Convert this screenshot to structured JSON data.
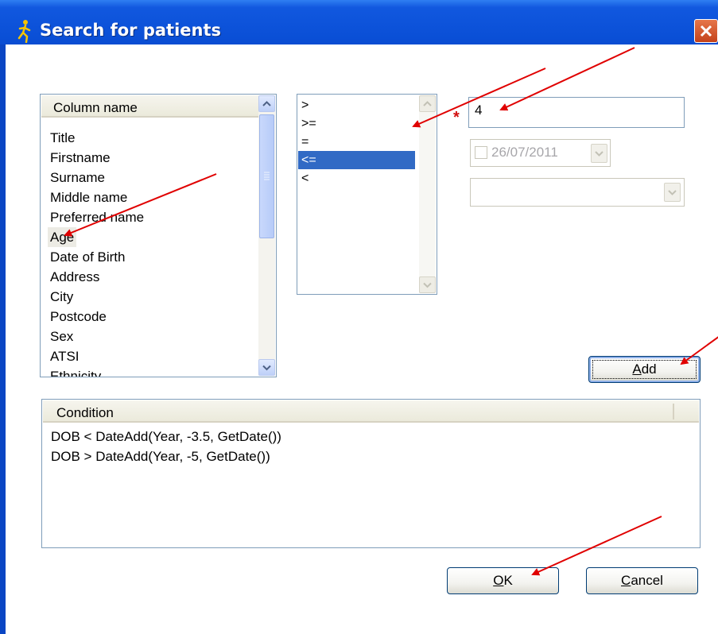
{
  "window": {
    "title": "Search for patients",
    "app_icon": "running-figure-icon",
    "close_icon": "close-x-icon",
    "titlebar_color": "#0a4fd6",
    "close_color": "#c4421a"
  },
  "columns": {
    "header": "Column name",
    "items": [
      "Title",
      "Firstname",
      "Surname",
      "Middle name",
      "Preferred name",
      "Age",
      "Date of Birth",
      "Address",
      "City",
      "Postcode",
      "Sex",
      "ATSI",
      "Ethnicity"
    ],
    "selected": "Age"
  },
  "operators": {
    "items": [
      ">",
      ">=",
      "=",
      "<=",
      "<"
    ],
    "selected": "<=",
    "selected_color": "#316ac5"
  },
  "value": {
    "text": "4",
    "required_marker": "*",
    "date": "26/07/2011",
    "date_checked": false
  },
  "buttons": {
    "add": "Add",
    "ok": "OK",
    "cancel": "Cancel"
  },
  "conditions": {
    "header": "Condition",
    "rows": [
      "DOB < DateAdd(Year, -3.5, GetDate())",
      "DOB > DateAdd(Year, -5, GetDate())"
    ]
  },
  "annotations": {
    "arrow_color": "#e00000"
  }
}
